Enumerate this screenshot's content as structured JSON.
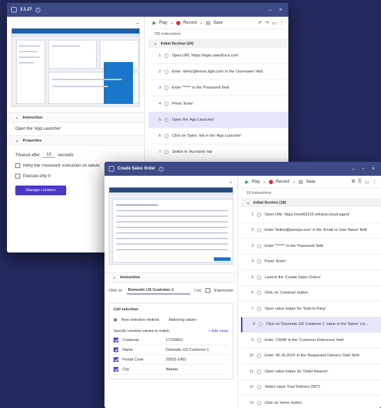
{
  "back_window": {
    "version": "2.1.27",
    "nav_icon": "arrow-right-icon",
    "toolbar": {
      "play": "Play",
      "record": "Record",
      "save": "Save"
    },
    "instructions_count": "705 instructions",
    "section": "Initial Section (24)",
    "steps": [
      {
        "n": "1",
        "text": "Open URL 'https://login.salesforce.com'"
      },
      {
        "n": "2",
        "text": "Enter 'demo@lemon.light.com' in the 'Username' field"
      },
      {
        "n": "3",
        "text": "Enter '*****' in the 'Password' field"
      },
      {
        "n": "4",
        "text": "Press 'Enter'"
      },
      {
        "n": "5",
        "text": "Open the 'App Launcher'"
      },
      {
        "n": "6",
        "text": "Click on 'Sales' link in the 'App Launcher'"
      },
      {
        "n": "7",
        "text": "Switch to 'Accounts' tab"
      }
    ],
    "instruction_header": "Instruction",
    "instruction_text": "Open the 'App Launcher'",
    "properties_header": "Properties",
    "timeout_label": "Timeout after",
    "timeout_value": "10",
    "timeout_unit": "seconds",
    "checkbox1_label": "Retry the 'Password' instruction on failure",
    "checkbox2_label": "Execute only if",
    "manage_btn": "Manage Locators"
  },
  "front_window": {
    "title": "Create Sales Order",
    "toolbar": {
      "play": "Play",
      "record": "Record",
      "save": "Save"
    },
    "instructions_count": "18 instructions",
    "section": "Initial Section (18)",
    "steps": [
      {
        "n": "1",
        "text": "Open URL 'https://my403125.s4hana.cloud.sap/ui'"
      },
      {
        "n": "2",
        "text": "Enter 'bolina@panaya.com' in the 'Email or User Name' field"
      },
      {
        "n": "3",
        "text": "Enter '******' in the 'Password' field"
      },
      {
        "n": "4",
        "text": "Press 'Enter'"
      },
      {
        "n": "5",
        "text": "Launch the 'Create Sales Orders'"
      },
      {
        "n": "6",
        "text": "Click on 'Continue' button"
      },
      {
        "n": "7",
        "text": "Open value helper for 'Sold-to Party'"
      },
      {
        "n": "8",
        "text": "Click on 'Domestic US Customer 1' value in the 'Name' col..."
      },
      {
        "n": "9",
        "text": "Enter '13048' in the 'Customer Reference' field"
      },
      {
        "n": "10",
        "text": "Enter '06.18.2024' in the 'Requested Delivery Date' field"
      },
      {
        "n": "11",
        "text": "Open value helper for 'Order Reason'"
      },
      {
        "n": "12",
        "text": "Select value 'Fast Delivery (007)'"
      },
      {
        "n": "13",
        "text": "Click on 'Items' button"
      }
    ],
    "instruction_header": "Instruction",
    "click_on_label": "Click on",
    "click_on_value": "Domestic US Customer 1",
    "fx_label": "f (x)",
    "expression_label": "Expression",
    "cell_selection": "Cell selection",
    "row_method_label": "Row selection method",
    "row_method_value": "Matching values",
    "specify_label": "Specify columns values to match",
    "add_value": "+ Add value",
    "kv_rows": [
      {
        "k": "Customer",
        "v": "17100001"
      },
      {
        "k": "Name",
        "v": "Domestic US Customer 1"
      },
      {
        "k": "Postal Code",
        "v": "20015-1452"
      },
      {
        "k": "City",
        "v": "Atlanta"
      }
    ]
  }
}
